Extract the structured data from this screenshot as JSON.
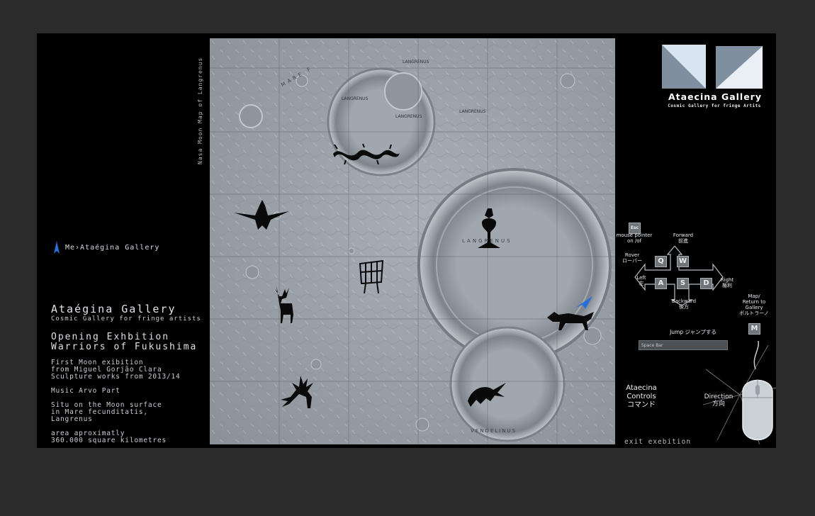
{
  "nav": {
    "marker_label": "Me›Ataégina Gallery"
  },
  "info": {
    "gallery_title": "Ataégina Gallery",
    "gallery_subtitle": "Cosmic Gallery for fringe artists",
    "exhibition_line1": "Opening Exhbition",
    "exhibition_line2": "Warriors of Fukushima",
    "desc": "First Moon exibition\nfrom Miguel Gorjão Clara\nSculpture works from 2013/14",
    "music": "Music Arvo Part",
    "location": "Situ on the Moon surface\nin Mare fecunditatis,\nLangrenus",
    "area": "area aproximatly\n360.000 square kilometres"
  },
  "map": {
    "vertical_label": "Nasa Moon Map of Langrenus",
    "place_labels": [
      "LANGRENUS",
      "LANGRENUS",
      "LANGRENUS",
      "LANGRENUS",
      "LANGRENUS",
      "VENDELINUS",
      "MARE F"
    ]
  },
  "logo": {
    "title": "Ataecina Gallery",
    "subtitle": "Cosmic Gallery for fringe Artits"
  },
  "controls": {
    "esc_key": "Esc",
    "esc_label": "mouse pointer\non /of",
    "forward": "Forward\n前進",
    "rover": "Rover\nローバー",
    "left": "Left\n左",
    "right": "Right\n権利",
    "backward": "Backward\n後方",
    "keys": {
      "q": "Q",
      "w": "W",
      "a": "A",
      "s": "S",
      "d": "D",
      "m": "M"
    },
    "map_return": "Map/\nReturn to\nGallery\nボルトラーノ",
    "jump": "Jump ジャンプする",
    "space_bar": "Space Bar",
    "title": "Ataecina\nControls\nコマンド",
    "direction": "Direction\n方向",
    "exit": "exit exebition"
  },
  "colors": {
    "background": "#2b2b2b",
    "panel": "#000000",
    "map_base": "#9aa0a8",
    "accent": "#2a6fd8"
  },
  "icons": [
    "location-arrow-icon",
    "mouse-icon",
    "arrow-cross-icon",
    "player-arrow-icon",
    "logo-triangle-icon"
  ]
}
